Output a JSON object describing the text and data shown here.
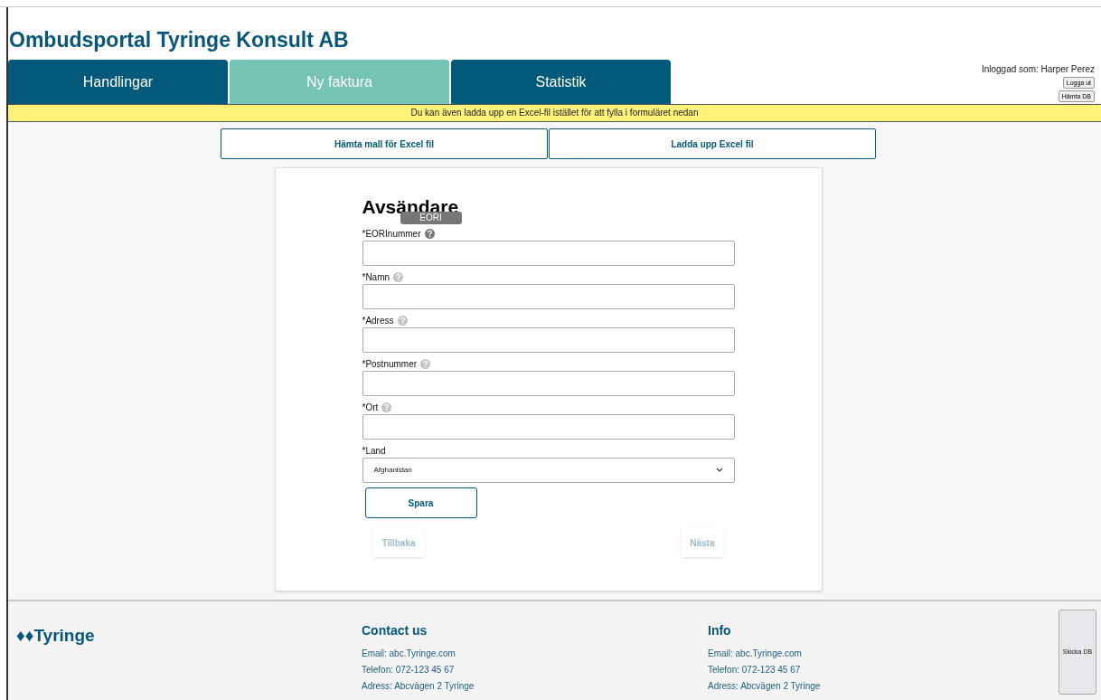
{
  "header": {
    "title": "Ombudsportal Tyringe Konsult AB"
  },
  "tabs": [
    {
      "label": "Handlingar",
      "selected": false
    },
    {
      "label": "Ny faktura",
      "selected": true
    },
    {
      "label": "Statistik",
      "selected": false
    }
  ],
  "user": {
    "logged_in": "Inloggad som: Harper Perez",
    "buttons": [
      "Logga ut",
      "Hämta DB"
    ]
  },
  "notice": "Du kan även ladda upp en Excel-fil istället för att fylla i formuläret nedan",
  "excel_buttons": [
    "Hämta mall för Excel fil",
    "Ladda upp Excel fil"
  ],
  "form": {
    "heading": "Avsändare",
    "fields": [
      {
        "kind": "text",
        "label": "*EORInummer",
        "help": true,
        "help_active": true,
        "tooltip": "EORI"
      },
      {
        "kind": "text",
        "label": "*Namn",
        "help": true,
        "help_active": false
      },
      {
        "kind": "text",
        "label": "*Adress",
        "help": true,
        "help_active": false
      },
      {
        "kind": "text",
        "label": "*Postnummer",
        "help": true,
        "help_active": false
      },
      {
        "kind": "text",
        "label": "*Ort",
        "help": true,
        "help_active": false
      },
      {
        "kind": "select",
        "label": "*Land",
        "help": false,
        "value": "Afghanistan"
      }
    ],
    "save": "Spara",
    "nav": [
      {
        "label": "Tillbaka",
        "disabled": true
      },
      {
        "label": "Nästa",
        "disabled": true
      }
    ]
  },
  "footer": {
    "logo": "♦♦Tyringe",
    "columns": [
      {
        "heading": "Contact us",
        "lines": [
          "Email: abc.Tyringe.com",
          "Telefon: 072-123 45 67",
          "Adress: Abcvägen 2 Tyringe"
        ]
      },
      {
        "heading": "Info",
        "lines": [
          "Email: abc.Tyringe.com",
          "Telefon: 072-123 45 67",
          "Adress: Abcvägen 2 Tyringe"
        ]
      }
    ],
    "send_button": "Skicka DB"
  }
}
